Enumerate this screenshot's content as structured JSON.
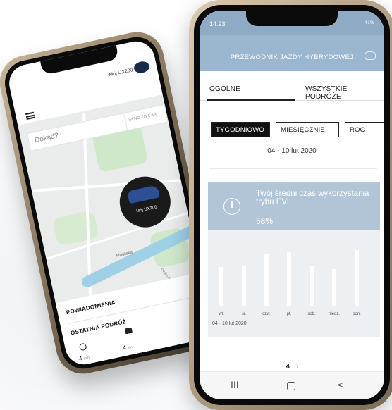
{
  "left_phone": {
    "car_name": "Mój UX200",
    "search_placeholder": "Dokąd?",
    "send_to_car": "SEND TO CAR",
    "pin_label": "Mój UX200",
    "map_label_1": "Mogilska",
    "map_label_2": "Ofiar Dąbia",
    "notifications_label": "POWIADOMIENIA",
    "last_trip_label": "OSTATNIA PODRÓŻ",
    "trip_minutes_value": "4",
    "trip_minutes_unit": "min",
    "trip_km_value": "4",
    "trip_km_unit": "km"
  },
  "right_phone": {
    "status_time": "14:23",
    "status_signal": "41%",
    "header_title": "PRZEWODNIK JAZDY HYBRYDOWEJ",
    "tabs": [
      {
        "label": "OGÓLNE",
        "active": true
      },
      {
        "label": "WSZYSTKIE PODRÓŻE",
        "active": false
      }
    ],
    "periods": [
      {
        "label": "TYGODNIOWO",
        "active": true
      },
      {
        "label": "MIESIĘCZNIE",
        "active": false
      },
      {
        "label": "ROC",
        "active": false
      }
    ],
    "date_range": "04 - 10 lut 2020",
    "card": {
      "text": "Twój średni czas wykorzystania trybu EV:",
      "value": "58%"
    },
    "bar_range_label": "04 - 10 lut 2020",
    "pager": {
      "current": "4",
      "other": "6"
    },
    "nav": {
      "recent": "III",
      "home": "○",
      "back": "<"
    }
  },
  "chart_data": {
    "type": "bar",
    "categories": [
      "wt.",
      "śr.",
      "czw.",
      "pt.",
      "sob.",
      "niedz.",
      "pon."
    ],
    "values": [
      0.58,
      0.6,
      0.77,
      0.8,
      0.6,
      0.55,
      0.83
    ],
    "ylim": [
      0,
      1
    ],
    "grid": false
  },
  "colors": {
    "header_blue": "#9bb6cf",
    "card_blue": "#b2c5d7",
    "card_bg": "#edf0f3",
    "accent_dark": "#111111"
  }
}
